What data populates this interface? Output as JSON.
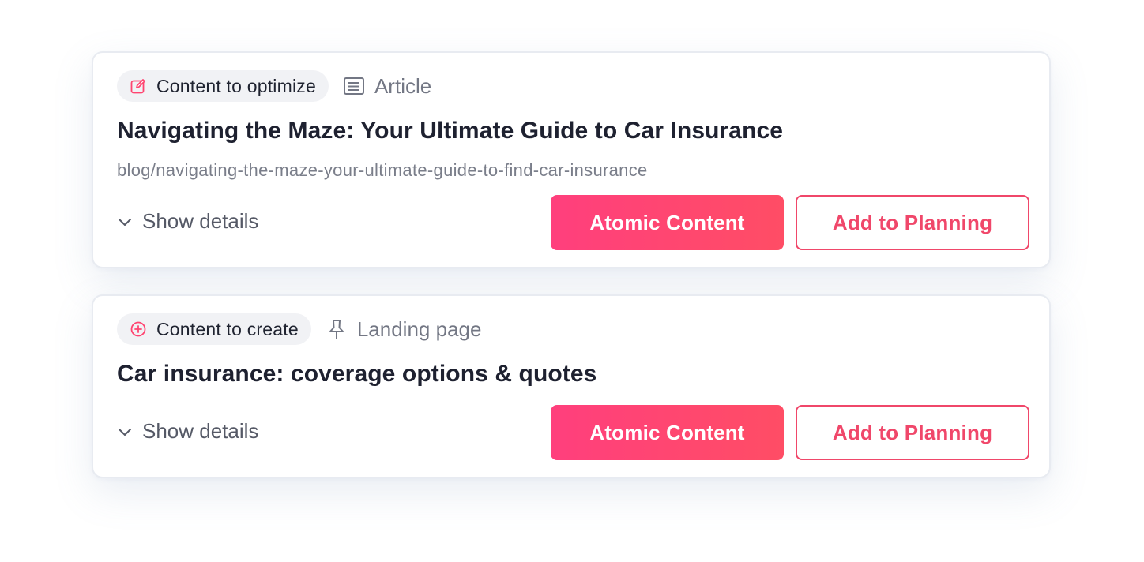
{
  "colors": {
    "accent": "#ff4470",
    "accent_gradient_start": "#ff3f7d",
    "accent_gradient_end": "#ff4d65",
    "title_text": "#1e2130",
    "muted_text": "#737784",
    "pill_background": "#f1f2f5"
  },
  "cards": [
    {
      "status": {
        "label": "Content to optimize",
        "icon": "edit-icon"
      },
      "type": {
        "label": "Article",
        "icon": "article-icon"
      },
      "title": "Navigating the Maze: Your Ultimate Guide to Car Insurance",
      "slug": "blog/navigating-the-maze-your-ultimate-guide-to-find-car-insurance",
      "details_label": "Show details",
      "primary_button": "Atomic Content",
      "secondary_button": "Add to Planning"
    },
    {
      "status": {
        "label": "Content to create",
        "icon": "add-circle-icon"
      },
      "type": {
        "label": "Landing page",
        "icon": "pin-icon"
      },
      "title": "Car insurance: coverage options & quotes",
      "details_label": "Show details",
      "primary_button": "Atomic Content",
      "secondary_button": "Add to Planning"
    }
  ]
}
